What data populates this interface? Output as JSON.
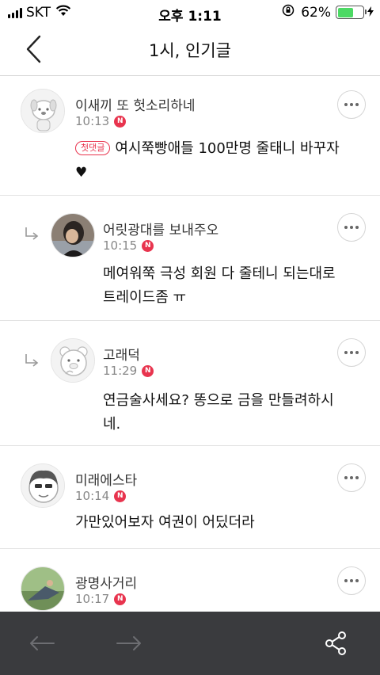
{
  "status_bar": {
    "carrier": "SKT",
    "time": "오후 1:11",
    "battery_text": "62%",
    "battery_level": 0.62,
    "battery_color": "#4cd964"
  },
  "nav": {
    "title": "1시, 인기글",
    "back_icon": "chevron-left-icon"
  },
  "comments": [
    {
      "name": "이새끼 또 헛소리하네",
      "time": "10:13",
      "badge": "N",
      "tag": "첫댓글",
      "text": "여시쭉빵애들 100만명 줄태니 바꾸자",
      "text_extra": "♥",
      "is_reply": false
    },
    {
      "name": "어릿광대를 보내주오",
      "time": "10:15",
      "badge": "N",
      "text_line1": "메여워쭉 극성 회원 다 줄테니 되는대로",
      "text_line2": "트레이드좀 ㅠ",
      "is_reply": true
    },
    {
      "name": "고래덕",
      "time": "11:29",
      "badge": "N",
      "text_line1": "연금술사세요? 똥으로 금을 만들려하시",
      "text_line2": "네.",
      "is_reply": true
    },
    {
      "name": "미래에스타",
      "time": "10:14",
      "badge": "N",
      "text": "가만있어보자 여권이 어딨더라",
      "is_reply": false
    },
    {
      "name": "광명사거리",
      "time": "10:17",
      "badge": "N",
      "is_reply": false
    }
  ],
  "toolbar": {
    "back_icon": "arrow-left-icon",
    "forward_icon": "arrow-right-icon",
    "share_icon": "share-icon"
  },
  "colors": {
    "accent": "#e8344e",
    "toolbar_bg": "#3a3b3e"
  }
}
